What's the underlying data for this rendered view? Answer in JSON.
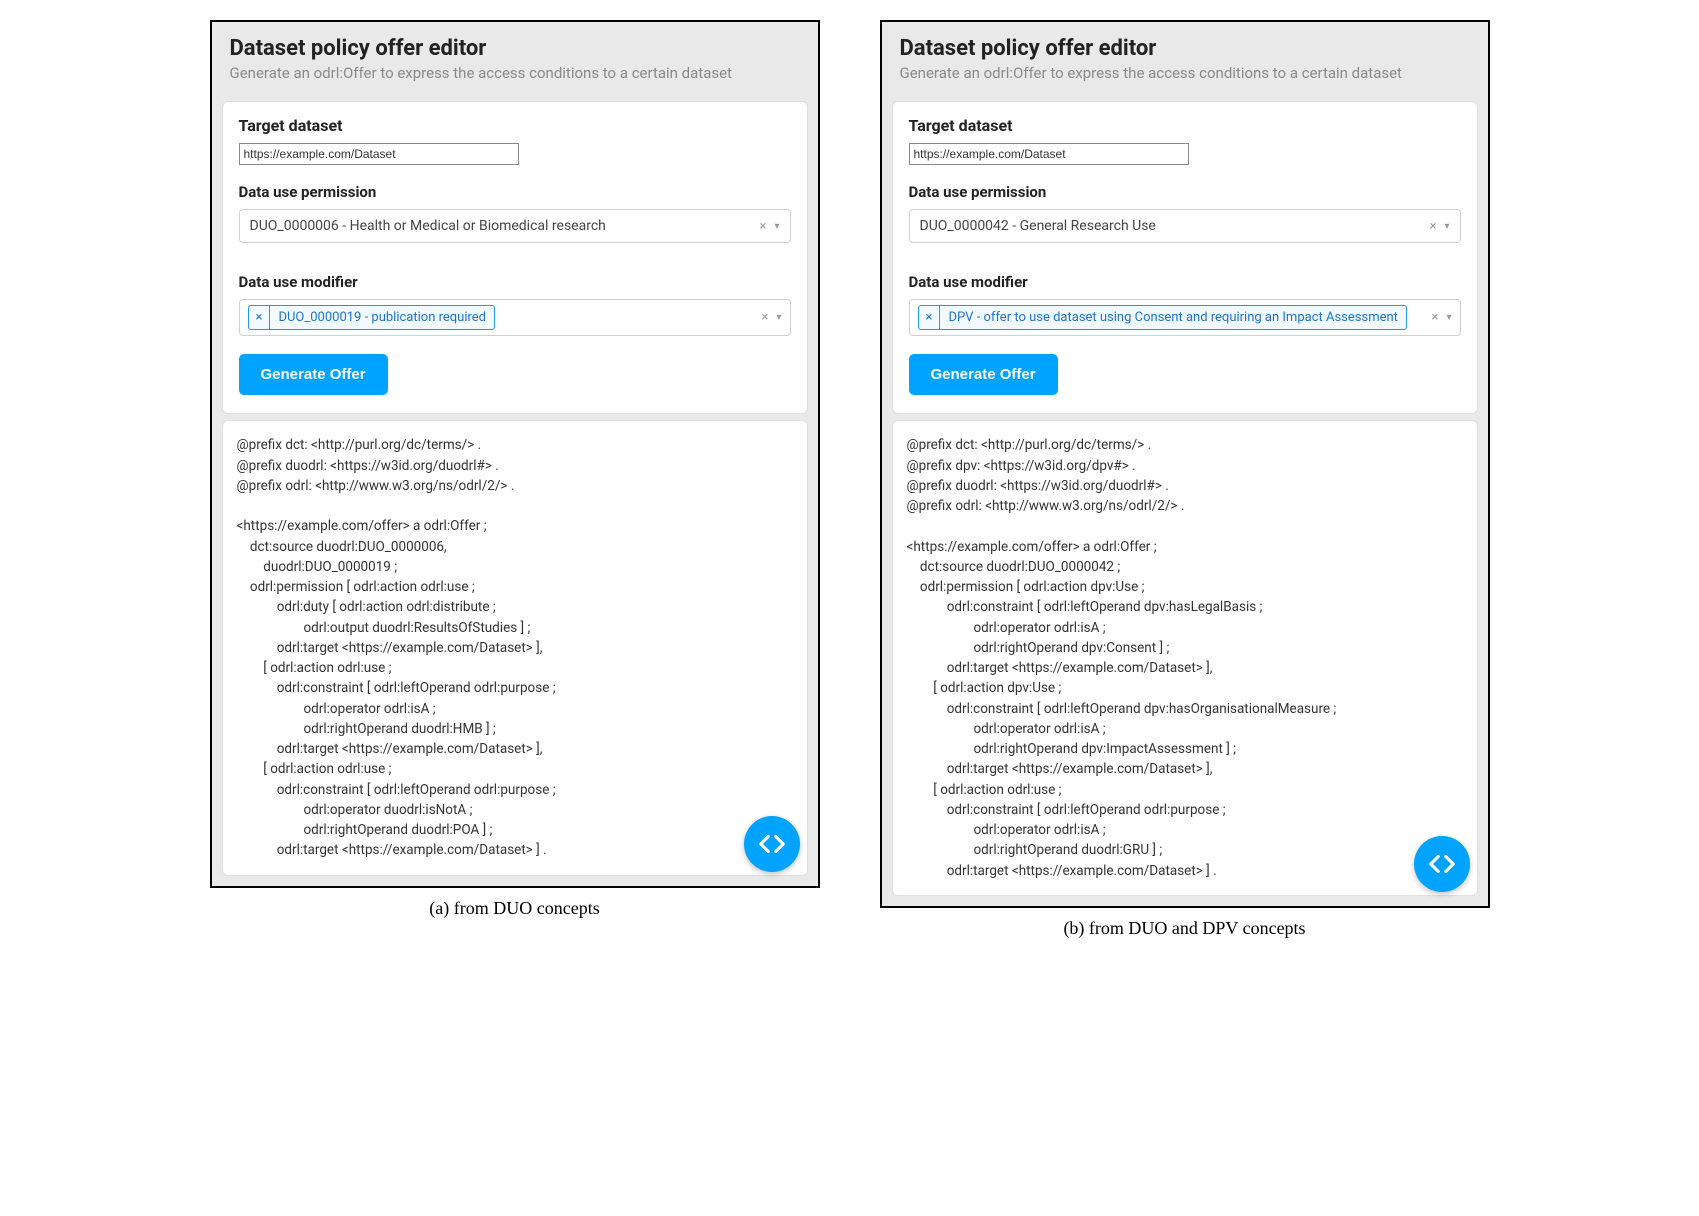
{
  "header": {
    "title": "Dataset policy offer editor",
    "subtitle": "Generate an odrl:Offer to express the access conditions to a certain dataset"
  },
  "labels": {
    "target_dataset": "Target dataset",
    "data_use_permission": "Data use permission",
    "data_use_modifier": "Data use modifier",
    "generate_button": "Generate Offer"
  },
  "left": {
    "dataset_value": "https://example.com/Dataset",
    "permission_value": "DUO_0000006 - Health or Medical or Biomedical research",
    "modifier_tag": "DUO_0000019 - publication required",
    "caption": "(a)  from DUO concepts",
    "output": "@prefix dct: <http://purl.org/dc/terms/> .\n@prefix duodrl: <https://w3id.org/duodrl#> .\n@prefix odrl: <http://www.w3.org/ns/odrl/2/> .\n\n<https://example.com/offer> a odrl:Offer ;\n    dct:source duodrl:DUO_0000006,\n        duodrl:DUO_0000019 ;\n    odrl:permission [ odrl:action odrl:use ;\n            odrl:duty [ odrl:action odrl:distribute ;\n                    odrl:output duodrl:ResultsOfStudies ] ;\n            odrl:target <https://example.com/Dataset> ],\n        [ odrl:action odrl:use ;\n            odrl:constraint [ odrl:leftOperand odrl:purpose ;\n                    odrl:operator odrl:isA ;\n                    odrl:rightOperand duodrl:HMB ] ;\n            odrl:target <https://example.com/Dataset> ],\n        [ odrl:action odrl:use ;\n            odrl:constraint [ odrl:leftOperand odrl:purpose ;\n                    odrl:operator duodrl:isNotA ;\n                    odrl:rightOperand duodrl:POA ] ;\n            odrl:target <https://example.com/Dataset> ] ."
  },
  "right": {
    "dataset_value": "https://example.com/Dataset",
    "permission_value": "DUO_0000042 - General Research Use",
    "modifier_tag": "DPV - offer to use dataset using Consent and requiring an Impact Assessment",
    "caption": "(b)  from DUO and DPV concepts",
    "output": "@prefix dct: <http://purl.org/dc/terms/> .\n@prefix dpv: <https://w3id.org/dpv#> .\n@prefix duodrl: <https://w3id.org/duodrl#> .\n@prefix odrl: <http://www.w3.org/ns/odrl/2/> .\n\n<https://example.com/offer> a odrl:Offer ;\n    dct:source duodrl:DUO_0000042 ;\n    odrl:permission [ odrl:action dpv:Use ;\n            odrl:constraint [ odrl:leftOperand dpv:hasLegalBasis ;\n                    odrl:operator odrl:isA ;\n                    odrl:rightOperand dpv:Consent ] ;\n            odrl:target <https://example.com/Dataset> ],\n        [ odrl:action dpv:Use ;\n            odrl:constraint [ odrl:leftOperand dpv:hasOrganisationalMeasure ;\n                    odrl:operator odrl:isA ;\n                    odrl:rightOperand dpv:ImpactAssessment ] ;\n            odrl:target <https://example.com/Dataset> ],\n        [ odrl:action odrl:use ;\n            odrl:constraint [ odrl:leftOperand odrl:purpose ;\n                    odrl:operator odrl:isA ;\n                    odrl:rightOperand duodrl:GRU ] ;\n            odrl:target <https://example.com/Dataset> ] ."
  }
}
